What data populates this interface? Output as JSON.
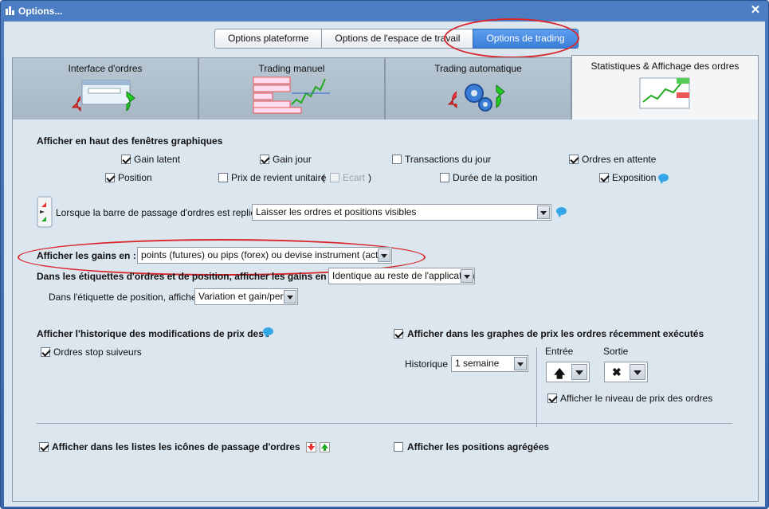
{
  "window": {
    "title": "Options..."
  },
  "top_tabs": [
    {
      "label": "Options plateforme"
    },
    {
      "label": "Options de l'espace de travail"
    },
    {
      "label": "Options de trading",
      "active": true
    }
  ],
  "sub_tabs": [
    {
      "label": "Interface d'ordres"
    },
    {
      "label": "Trading manuel"
    },
    {
      "label": "Trading automatique"
    },
    {
      "label": "Statistiques & Affichage des ordres",
      "active": true
    }
  ],
  "chart_windows": {
    "heading": "Afficher en haut des fenêtres graphiques",
    "gain_latent": {
      "label": "Gain latent",
      "checked": true
    },
    "gain_jour": {
      "label": "Gain jour",
      "checked": true
    },
    "transactions_jour": {
      "label": "Transactions du jour",
      "checked": false
    },
    "ordres_attente": {
      "label": "Ordres en attente",
      "checked": true
    },
    "position": {
      "label": "Position",
      "checked": true
    },
    "prix_revient": {
      "label": "Prix de revient unitaire",
      "checked": false
    },
    "paren_open": "(",
    "ecart": {
      "label": "Ecart",
      "checked": false,
      "disabled": true
    },
    "paren_close": ")",
    "duree_position": {
      "label": "Durée de la position",
      "checked": false
    },
    "exposition": {
      "label": "Exposition",
      "checked": true
    }
  },
  "collapsed_bar": {
    "label": "Lorsque la barre de passage d'ordres est repliée :",
    "value": "Laisser les ordres et positions visibles"
  },
  "gains": {
    "label": "Afficher les gains en :",
    "value": "points (futures) ou pips (forex) ou devise instrument (actions)"
  },
  "labels_gains": {
    "label": "Dans les étiquettes d'ordres et de position, afficher les gains en :",
    "value": "Identique au reste de l'application"
  },
  "position_label": {
    "label": "Dans l'étiquette de position, afficher :",
    "value": "Variation et gain/perte"
  },
  "history": {
    "heading": "Afficher l'historique des modifications de prix des :",
    "stop_suiveurs": {
      "label": "Ordres stop suiveurs",
      "checked": true
    }
  },
  "recent_orders": {
    "heading": "Afficher dans les graphes de prix les ordres récemment exécutés",
    "checked": true,
    "historique_label": "Historique",
    "historique_value": "1 semaine",
    "entree_label": "Entrée",
    "sortie_label": "Sortie",
    "entree_glyph": "🡅",
    "sortie_glyph": "✖",
    "niveau_prix": {
      "label": "Afficher le niveau de prix des ordres",
      "checked": true
    }
  },
  "bottom": {
    "icons_lists": {
      "label": "Afficher dans les listes les icônes de passage d'ordres",
      "checked": true
    },
    "positions_agregees": {
      "label": "Afficher les positions agrégées",
      "checked": false
    }
  }
}
